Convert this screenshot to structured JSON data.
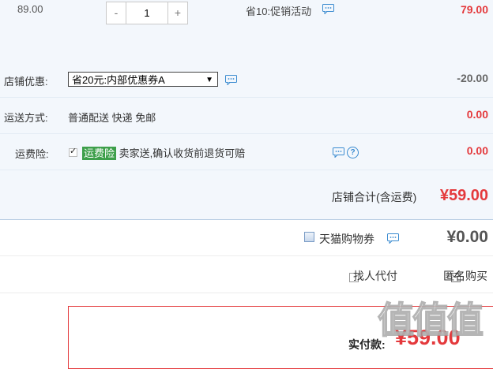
{
  "item": {
    "unit_price": "89.00",
    "quantity": "1",
    "minus_label": "-",
    "plus_label": "+",
    "promo": "省10:促销活动",
    "subtotal": "79.00"
  },
  "shop_coupon": {
    "label": "店铺优惠:",
    "selected": "省20元:内部优惠券A",
    "amount": "-20.00"
  },
  "shipping": {
    "label": "运送方式:",
    "value": "普通配送 快递 免邮",
    "amount": "0.00"
  },
  "insurance": {
    "label": "运费险:",
    "badge": "运费险",
    "description": "卖家送,确认收货前退货可赔",
    "amount": "0.00",
    "help": "?"
  },
  "shop_total": {
    "label": "店铺合计(含运费)",
    "amount": "¥59.00"
  },
  "tmall_coupon": {
    "label": "天猫购物券",
    "amount": "¥0.00"
  },
  "options": {
    "proxy_pay": "找人代付",
    "anonymous": "匿名购买"
  },
  "pay": {
    "label": "实付款:",
    "amount": "¥59.00"
  },
  "watermark": "值值值",
  "colors": {
    "accent_red": "#e4393c",
    "panel_bg": "#f3f7fc",
    "badge_green": "#3d9f4a"
  }
}
